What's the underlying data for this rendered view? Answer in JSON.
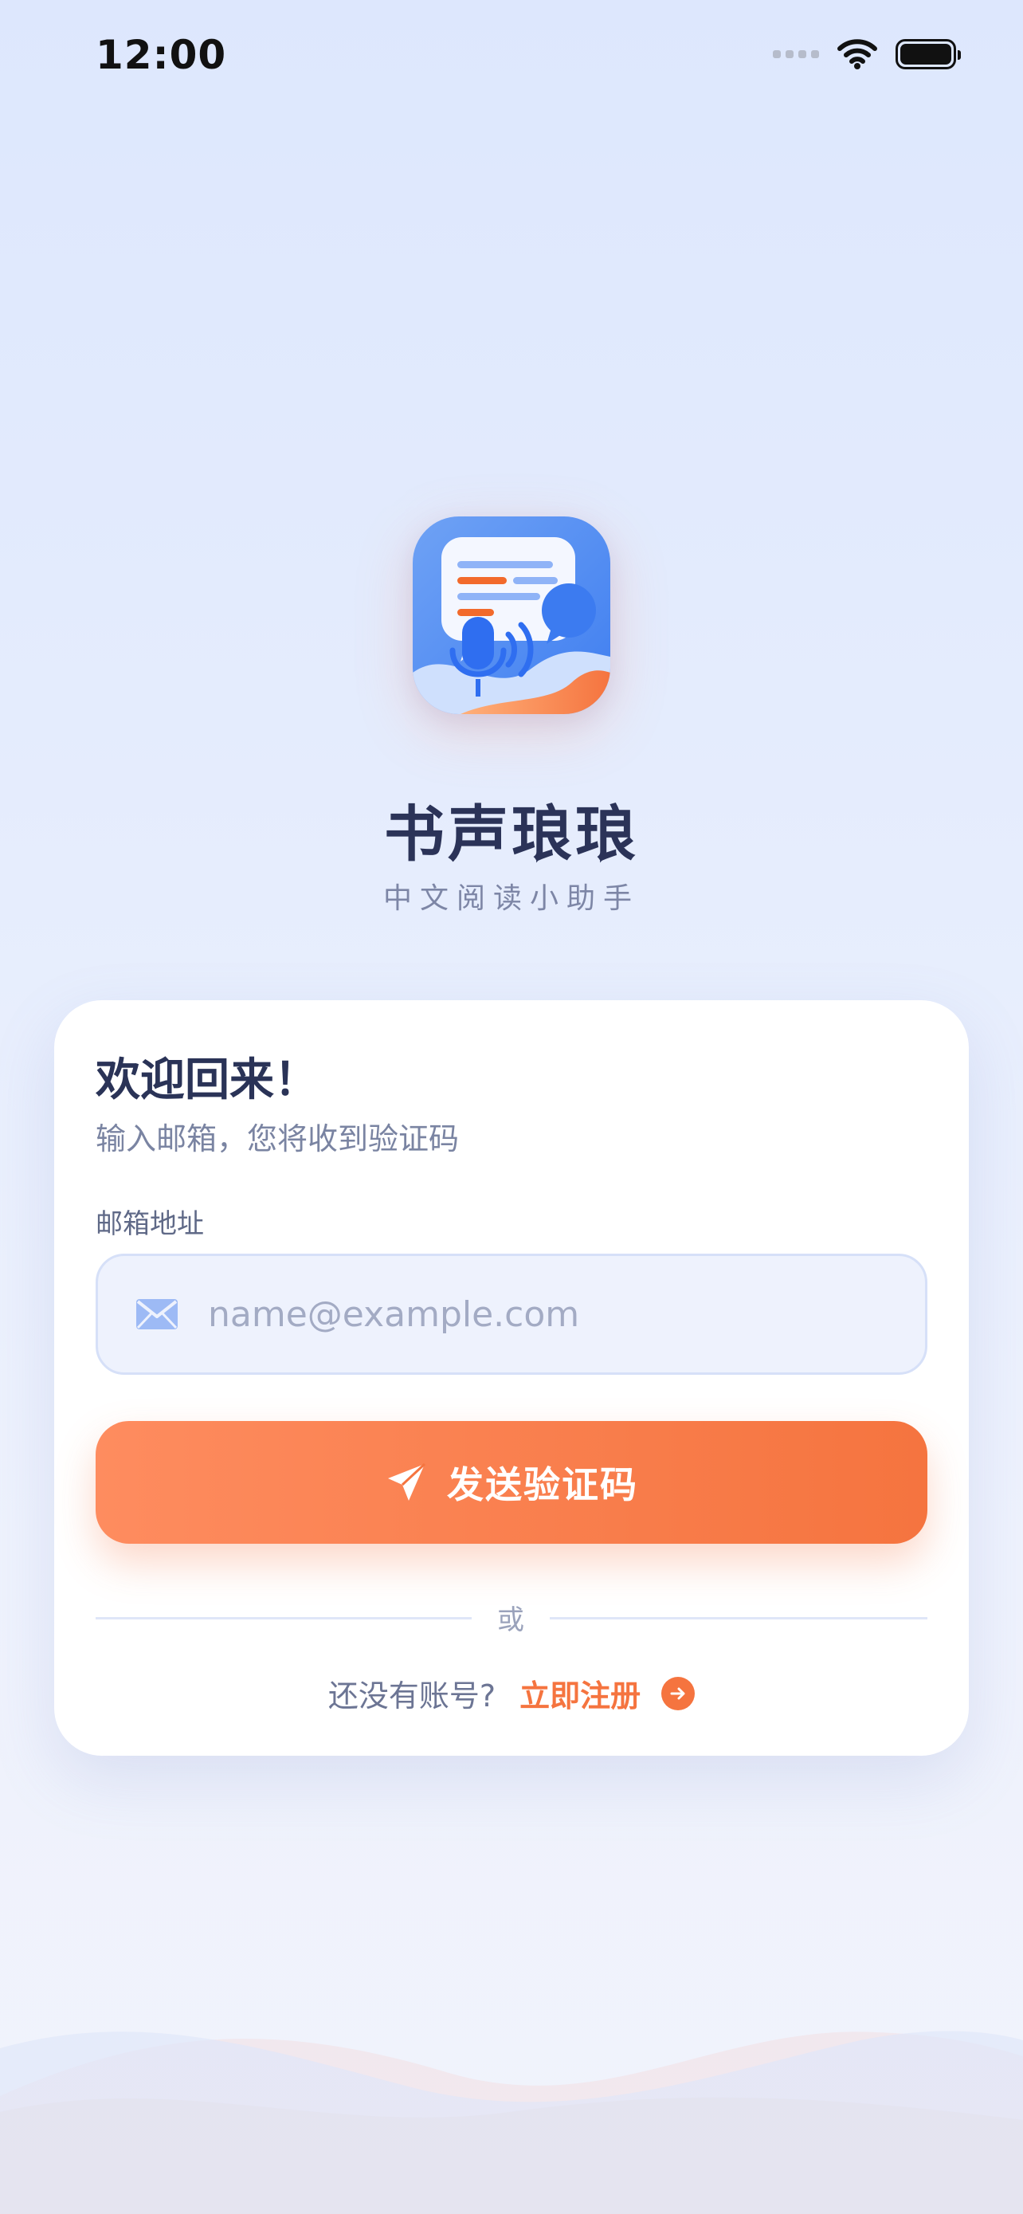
{
  "status_bar": {
    "time": "12:00"
  },
  "app": {
    "name": "书声琅琅",
    "tagline": "中文阅读小助手"
  },
  "login_card": {
    "welcome": "欢迎回来！",
    "subtitle": "输入邮箱，您将收到验证码",
    "email_label": "邮箱地址",
    "email_placeholder": "name@example.com",
    "email_value": "",
    "send_button_label": "发送验证码",
    "divider_text": "或",
    "no_account_text": "还没有账号?",
    "register_link_label": "立即注册"
  },
  "colors": {
    "accent": "#f5743f",
    "title": "#2b3358",
    "muted": "#7a84a2",
    "input_bg": "#eef2fd",
    "background": "#e6edfd"
  },
  "icons": [
    "wifi-icon",
    "battery-icon",
    "mail-icon",
    "paper-plane-icon",
    "arrow-right-icon"
  ]
}
